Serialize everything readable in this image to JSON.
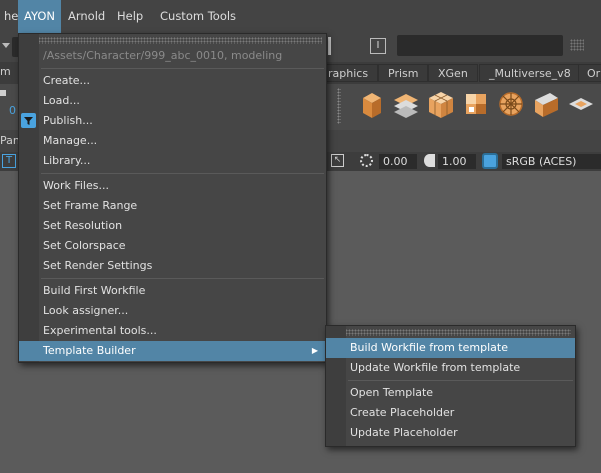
{
  "menubar": {
    "items": [
      "he",
      "AYON",
      "Arnold",
      "Help",
      "Custom Tools"
    ],
    "active_index": 1
  },
  "shelf_tabs": [
    "raphics",
    "Prism",
    "XGen",
    "_Multiverse_v8",
    "Or"
  ],
  "shelf_left_label": "m",
  "panel_label": "Pan",
  "viewport_bar": {
    "field1": "0.00",
    "field2": "1.00",
    "colorspace": "sRGB (ACES)"
  },
  "ayon_menu": {
    "context": "/Assets/Character/999_abc_0010, modeling",
    "groups": [
      [
        "Create...",
        "Load...",
        "Publish...",
        "Manage...",
        "Library..."
      ],
      [
        "Work Files...",
        "Set Frame Range",
        "Set Resolution",
        "Set Colorspace",
        "Set Render Settings"
      ],
      [
        "Build First Workfile",
        "Look assigner...",
        "Experimental tools...",
        "Template Builder"
      ]
    ],
    "highlighted": "Template Builder"
  },
  "template_submenu": {
    "groups": [
      [
        "Build Workfile from template",
        "Update Workfile from template"
      ],
      [
        "Open Template",
        "Create Placeholder",
        "Update Placeholder"
      ]
    ],
    "highlighted": "Build Workfile from template"
  },
  "colors": {
    "accent": "#5285a6",
    "shelf_icon": "#e8a35f"
  }
}
